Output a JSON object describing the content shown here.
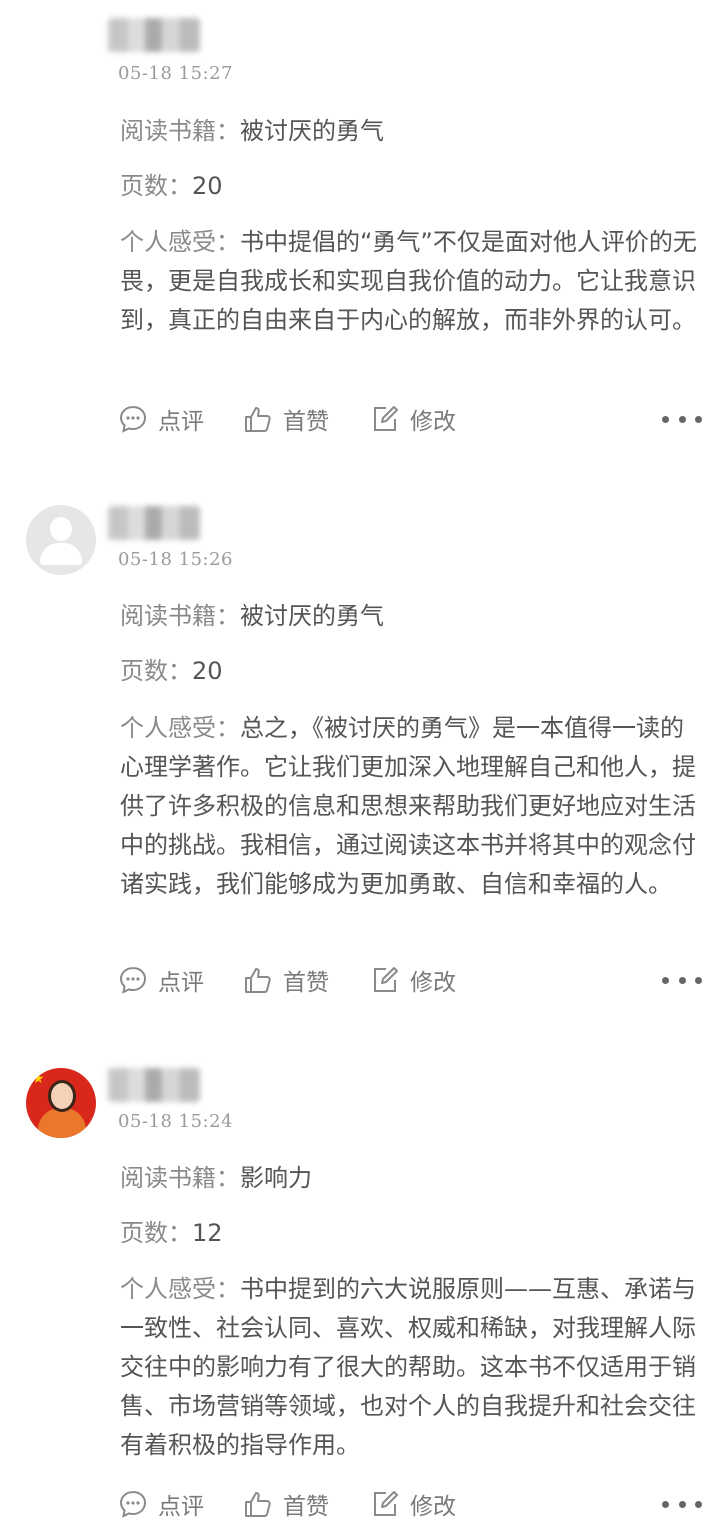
{
  "posts": [
    {
      "time": "05-18 15:27",
      "book_label": "阅读书籍：",
      "book": "被讨厌的勇气",
      "pages_label": "页数：",
      "pages": "20",
      "feel_label": "个人感受：",
      "feel": "书中提倡的“勇气”不仅是面对他人评价的无畏，更是自我成长和实现自我价值的动力。它让我意识到，真正的自由来自于内心的解放，而非外界的认可。",
      "actions": {
        "comment": "点评",
        "like": "首赞",
        "edit": "修改"
      }
    },
    {
      "time": "05-18 15:26",
      "book_label": "阅读书籍：",
      "book": "被讨厌的勇气",
      "pages_label": "页数：",
      "pages": "20",
      "feel_label": "个人感受：",
      "feel": "总之，《被讨厌的勇气》是一本值得一读的心理学著作。它让我们更加深入地理解自己和他人，提供了许多积极的信息和思想来帮助我们更好地应对生活中的挑战。我相信，通过阅读这本书并将其中的观念付诸实践，我们能够成为更加勇敢、自信和幸福的人。",
      "actions": {
        "comment": "点评",
        "like": "首赞",
        "edit": "修改"
      }
    },
    {
      "time": "05-18 15:24",
      "book_label": "阅读书籍：",
      "book": "影响力",
      "pages_label": "页数：",
      "pages": "12",
      "feel_label": "个人感受：",
      "feel": "书中提到的六大说服原则——互惠、承诺与一致性、社会认同、喜欢、权威和稀缺，对我理解人际交往中的影响力有了很大的帮助。这本书不仅适用于销售、市场营销等领域，也对个人的自我提升和社会交往有着积极的指导作用。",
      "actions": {
        "comment": "点评",
        "like": "首赞",
        "edit": "修改"
      }
    }
  ]
}
